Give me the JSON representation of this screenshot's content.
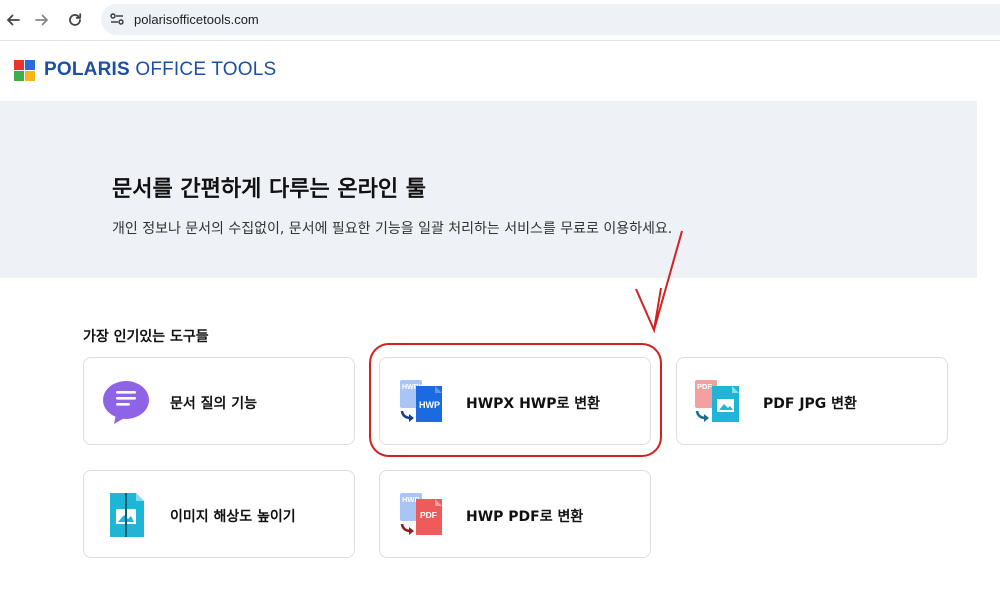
{
  "browser": {
    "url": "polarisofficetools.com",
    "icons": [
      "back-icon",
      "forward-icon",
      "reload-icon",
      "site-info-icon"
    ]
  },
  "header": {
    "logo_bold": "POLARIS",
    "logo_rest": " OFFICE TOOLS",
    "logo_colors": [
      "#e7322e",
      "#2d6ad8",
      "#3cae4a",
      "#f6b716"
    ]
  },
  "hero": {
    "title": "문서를 간편하게 다루는 온라인 툴",
    "subtitle": "개인 정보나 문서의 수집없이, 문서에 필요한 기능을 일괄 처리하는 서비스를 무료로 이용하세요."
  },
  "section": {
    "title": "가장 인기있는 도구들"
  },
  "tools": [
    {
      "label": "문서 질의 기능",
      "icon": "chat-document-icon"
    },
    {
      "label": "HWPX HWP로 변환",
      "icon": "hwpx-to-hwp-icon",
      "icon_text_top": "HWPX",
      "icon_text_front": "HWP"
    },
    {
      "label": "PDF JPG 변환",
      "icon": "pdf-to-jpg-icon",
      "icon_text_top": "PDF"
    },
    {
      "label": "이미지 해상도 높이기",
      "icon": "image-upscale-icon"
    },
    {
      "label": "HWP PDF로 변환",
      "icon": "hwp-to-pdf-icon",
      "icon_text_top": "HWP",
      "icon_text_front": "PDF"
    }
  ],
  "colors": {
    "annotation": "#d42020",
    "hero_bg": "#eef1f5",
    "brand": "#1c4fa8"
  }
}
